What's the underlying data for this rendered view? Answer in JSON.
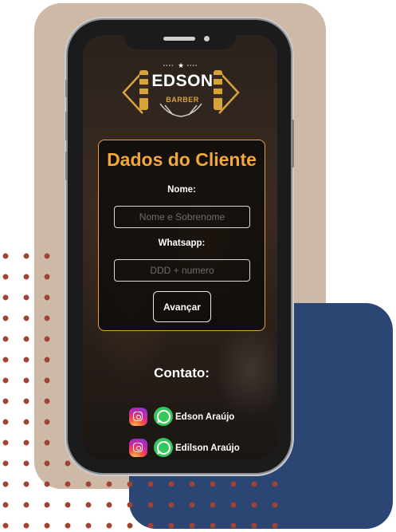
{
  "brand": {
    "name": "EDSON",
    "sub": "BARBER"
  },
  "form": {
    "title": "Dados do Cliente",
    "name_label": "Nome:",
    "name_placeholder": "Nome e Sobrenome",
    "phone_label": "Whatsapp:",
    "phone_placeholder": "DDD + numero",
    "submit_label": "Avançar"
  },
  "contact": {
    "title": "Contato:",
    "people": [
      {
        "name": "Edson Araújo",
        "icons": [
          "instagram-icon",
          "whatsapp-icon"
        ]
      },
      {
        "name": "Edilson Araújo",
        "icons": [
          "instagram-icon",
          "whatsapp-icon"
        ]
      }
    ]
  },
  "colors": {
    "accent": "#f0a83e",
    "beige": "#cdb9a6",
    "navy": "#2b4672",
    "dots": "#a14236"
  }
}
